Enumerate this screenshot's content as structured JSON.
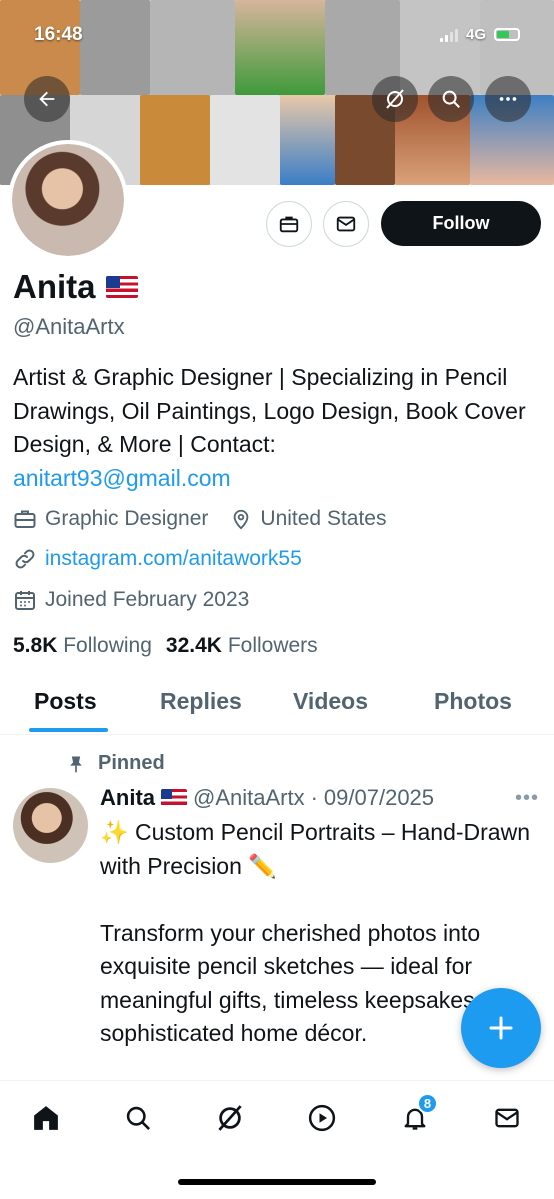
{
  "status_bar": {
    "time": "16:48",
    "network": "4G"
  },
  "profile": {
    "name": "Anita",
    "handle": "@AnitaArtx",
    "bio_text": "Artist & Graphic Designer | Specializing in Pencil Drawings, Oil Paintings, Logo Design, Book Cover Design, & More | Contact:",
    "bio_email": "anitart93@gmail.com",
    "profession": "Graphic Designer",
    "location": "United States",
    "website": "instagram.com/anitawork55",
    "joined": "Joined February 2023",
    "following_count": "5.8K",
    "following_label": "Following",
    "followers_count": "32.4K",
    "followers_label": "Followers",
    "follow_button": "Follow"
  },
  "tabs": [
    {
      "label": "Posts",
      "active": true
    },
    {
      "label": "Replies",
      "active": false
    },
    {
      "label": "Videos",
      "active": false
    },
    {
      "label": "Photos",
      "active": false
    }
  ],
  "post": {
    "pinned_label": "Pinned",
    "author": "Anita",
    "handle": "@AnitaArtx",
    "separator": "·",
    "date": "09/07/2025",
    "line1": "✨ Custom Pencil Portraits – Hand-Drawn with Precision ✏️",
    "line2": "Transform your cherished photos into exquisite pencil sketches — ideal for meaningful gifts, timeless keepsakes, or sophisticated home décor."
  },
  "nav": {
    "notifications_badge": "8"
  },
  "colors": {
    "accent": "#1d9bf0",
    "text": "#0f1419",
    "secondary": "#536471"
  }
}
